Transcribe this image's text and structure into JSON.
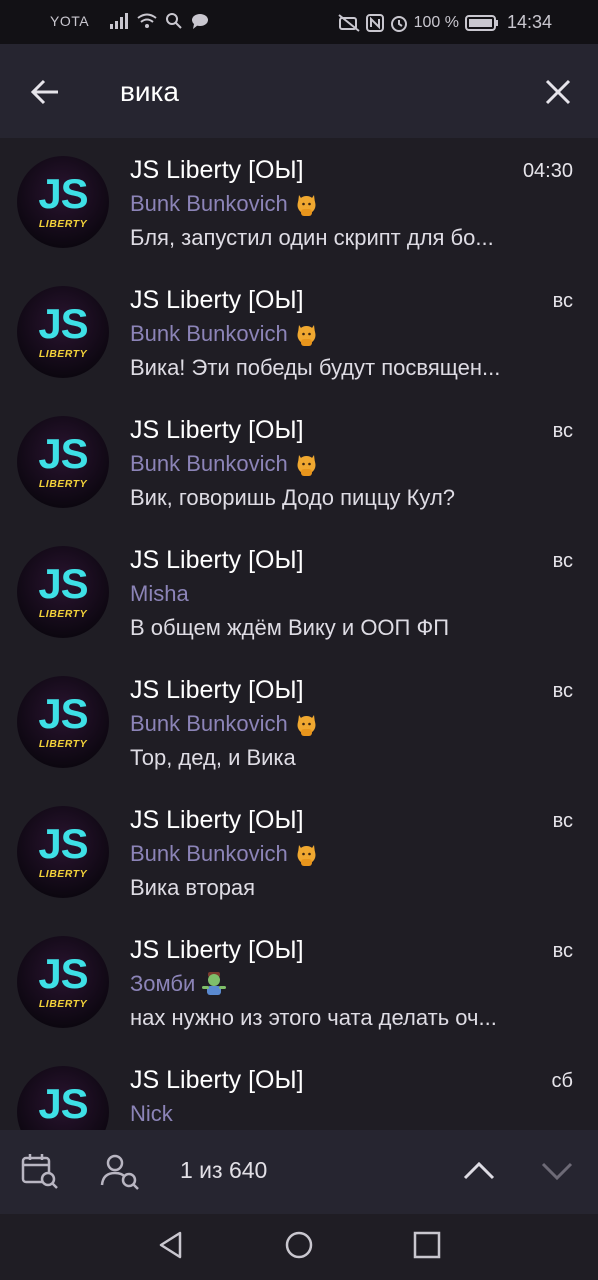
{
  "status_bar": {
    "carrier": "YOTA",
    "battery": "100 %",
    "time": "14:34"
  },
  "search": {
    "query": "вика",
    "placeholder": ""
  },
  "results": [
    {
      "title": "JS Liberty [ОЫ]",
      "time": "04:30",
      "sender": "Bunk Bunkovich",
      "sender_emoji": "cat",
      "message": "Бля, запустил один скрипт для бо..."
    },
    {
      "title": "JS Liberty [ОЫ]",
      "time": "вс",
      "sender": "Bunk Bunkovich",
      "sender_emoji": "cat",
      "message": "Вика! Эти победы будут посвящен..."
    },
    {
      "title": "JS Liberty [ОЫ]",
      "time": "вс",
      "sender": "Bunk Bunkovich",
      "sender_emoji": "cat",
      "message": "Вик, говоришь Додо пиццу Кул?"
    },
    {
      "title": "JS Liberty [ОЫ]",
      "time": "вс",
      "sender": "Misha",
      "sender_emoji": "",
      "message": "В общем ждём Вику и ООП ФП"
    },
    {
      "title": "JS Liberty [ОЫ]",
      "time": "вс",
      "sender": "Bunk Bunkovich",
      "sender_emoji": "cat",
      "message": "Тор, дед, и Вика"
    },
    {
      "title": "JS Liberty [ОЫ]",
      "time": "вс",
      "sender": "Bunk Bunkovich",
      "sender_emoji": "cat",
      "message": "Вика вторая"
    },
    {
      "title": "JS Liberty [ОЫ]",
      "time": "вс",
      "sender": "Зомби",
      "sender_emoji": "zombie",
      "message": "нах нужно из этого чата делать оч..."
    },
    {
      "title": "JS Liberty [ОЫ]",
      "time": "сб",
      "sender": "Nick",
      "sender_emoji": "",
      "message": ""
    }
  ],
  "avatar": {
    "main": "JS",
    "sub": "LIBERTY"
  },
  "toolbar": {
    "counter": "1 из 640",
    "icons": [
      "calendar-search-icon",
      "user-search-icon",
      "chevron-up-icon",
      "chevron-down-icon"
    ]
  },
  "colors": {
    "background": "#1f1d24",
    "header": "#262530",
    "sender": "#8c84b8",
    "avatar_accent": "#3ee0e6",
    "avatar_sub": "#f3d23a"
  }
}
